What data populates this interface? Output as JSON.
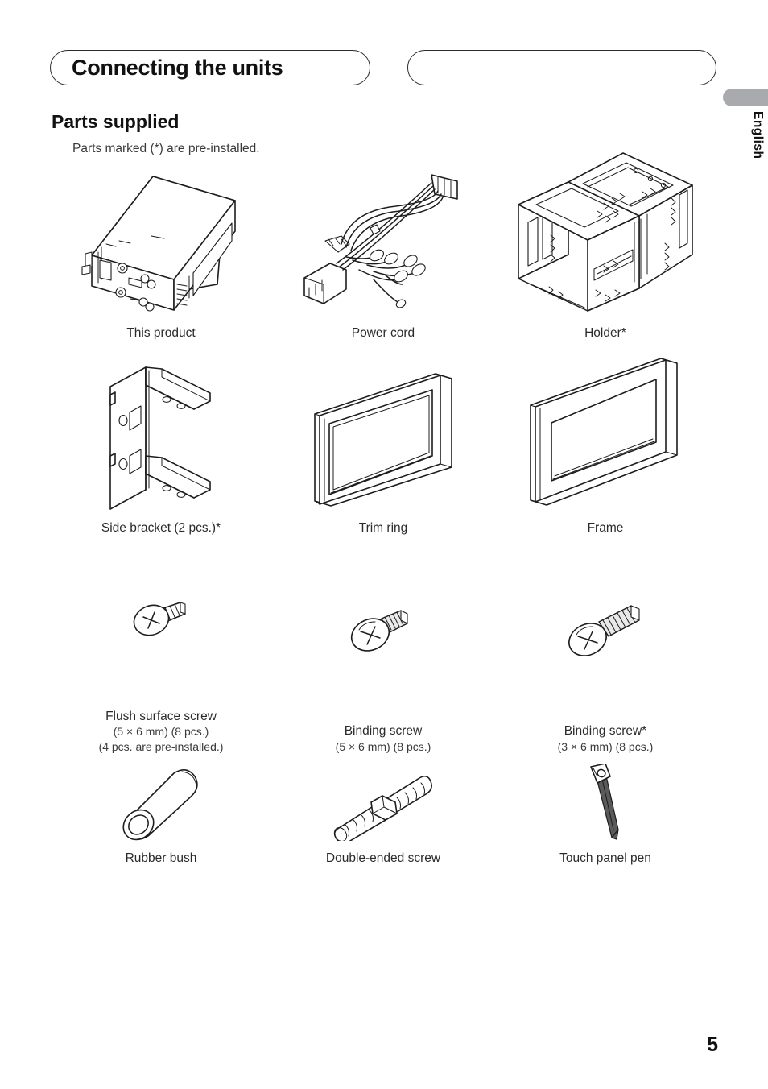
{
  "header": {
    "chapter_title": "Connecting the units",
    "second_pill_label": ""
  },
  "sidebar": {
    "language_label": "English",
    "tab_color": "#a8aaad"
  },
  "section": {
    "title": "Parts supplied",
    "note": "Parts marked (*) are pre-installed."
  },
  "parts": [
    [
      {
        "label": "This product",
        "sub": "",
        "sub2": "",
        "icon": "head-unit-illustration"
      },
      {
        "label": "Power cord",
        "sub": "",
        "sub2": "",
        "icon": "power-cord-illustration"
      },
      {
        "label": "Holder*",
        "sub": "",
        "sub2": "",
        "icon": "holder-illustration"
      }
    ],
    [
      {
        "label": "Side bracket (2 pcs.)*",
        "sub": "",
        "sub2": "",
        "icon": "side-bracket-illustration"
      },
      {
        "label": "Trim ring",
        "sub": "",
        "sub2": "",
        "icon": "trim-ring-illustration"
      },
      {
        "label": "Frame",
        "sub": "",
        "sub2": "",
        "icon": "frame-illustration"
      }
    ],
    [
      {
        "label": "Flush surface screw",
        "sub": "(5 × 6 mm) (8 pcs.)",
        "sub2": "(4 pcs. are pre-installed.)",
        "icon": "flush-surface-screw-illustration"
      },
      {
        "label": "Binding screw",
        "sub": "(5 × 6 mm) (8 pcs.)",
        "sub2": "",
        "icon": "binding-screw-illustration"
      },
      {
        "label": "Binding screw*",
        "sub": "(3 × 6 mm) (8 pcs.)",
        "sub2": "",
        "icon": "binding-screw-long-illustration"
      }
    ],
    [
      {
        "label": "Rubber bush",
        "sub": "",
        "sub2": "",
        "icon": "rubber-bush-illustration"
      },
      {
        "label": "Double-ended screw",
        "sub": "",
        "sub2": "",
        "icon": "double-ended-screw-illustration"
      },
      {
        "label": "Touch panel pen",
        "sub": "",
        "sub2": "",
        "icon": "touch-panel-pen-illustration"
      }
    ]
  ],
  "footer": {
    "page_number": "5"
  }
}
